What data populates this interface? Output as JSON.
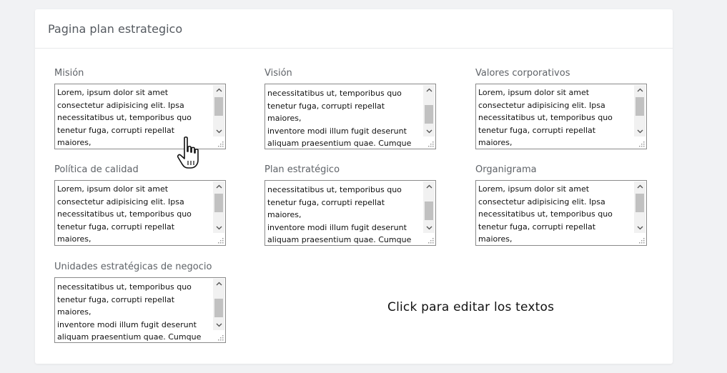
{
  "page": {
    "title": "Pagina plan estrategico"
  },
  "fields": [
    {
      "label": "Misión",
      "text": "Lorem, ipsum dolor sit amet\nconsectetur adipisicing elit. Ipsa\nnecessitatibus ut, temporibus quo\ntenetur fuga, corrupti repellat maiores,\ninventore modi illum fugit deserunt"
    },
    {
      "label": "Visión",
      "text": "necessitatibus ut, temporibus quo\ntenetur fuga, corrupti repellat maiores,\ninventore modi illum fugit deserunt\naliquam praesentium quae. Cumque\nbeatae perspiciatis nobis."
    },
    {
      "label": "Valores corporativos",
      "text": "Lorem, ipsum dolor sit amet\nconsectetur adipisicing elit. Ipsa\nnecessitatibus ut, temporibus quo\ntenetur fuga, corrupti repellat maiores,\ninventore modi illum fugit deserunt"
    },
    {
      "label": "Política de calidad",
      "text": "Lorem, ipsum dolor sit amet\nconsectetur adipisicing elit. Ipsa\nnecessitatibus ut, temporibus quo\ntenetur fuga, corrupti repellat maiores,\ninventore modi illum fugit deserunt"
    },
    {
      "label": "Plan estratégico",
      "text": "necessitatibus ut, temporibus quo\ntenetur fuga, corrupti repellat maiores,\ninventore modi illum fugit deserunt\naliquam praesentium quae. Cumque\nbeatae perspiciatis nobis."
    },
    {
      "label": "Organigrama",
      "text": "Lorem, ipsum dolor sit amet\nconsectetur adipisicing elit. Ipsa\nnecessitatibus ut, temporibus quo\ntenetur fuga, corrupti repellat maiores,\ninventore modi illum fugit deserunt"
    },
    {
      "label": "Unidades estratégicas de negocio",
      "text": "necessitatibus ut, temporibus quo\ntenetur fuga, corrupti repellat maiores,\ninventore modi illum fugit deserunt\naliquam praesentium quae. Cumque\nbeatae perspiciatis nobis."
    }
  ],
  "cta": {
    "text": "Click para editar los textos"
  },
  "icons": {
    "scroll_up": "chevron-up-icon",
    "scroll_down": "chevron-down-icon",
    "resize": "resize-grip-icon",
    "cursor": "hand-pointer-icon"
  },
  "colors": {
    "background": "#f1f2f4",
    "card": "#ffffff",
    "border": "#8a8a8a"
  }
}
